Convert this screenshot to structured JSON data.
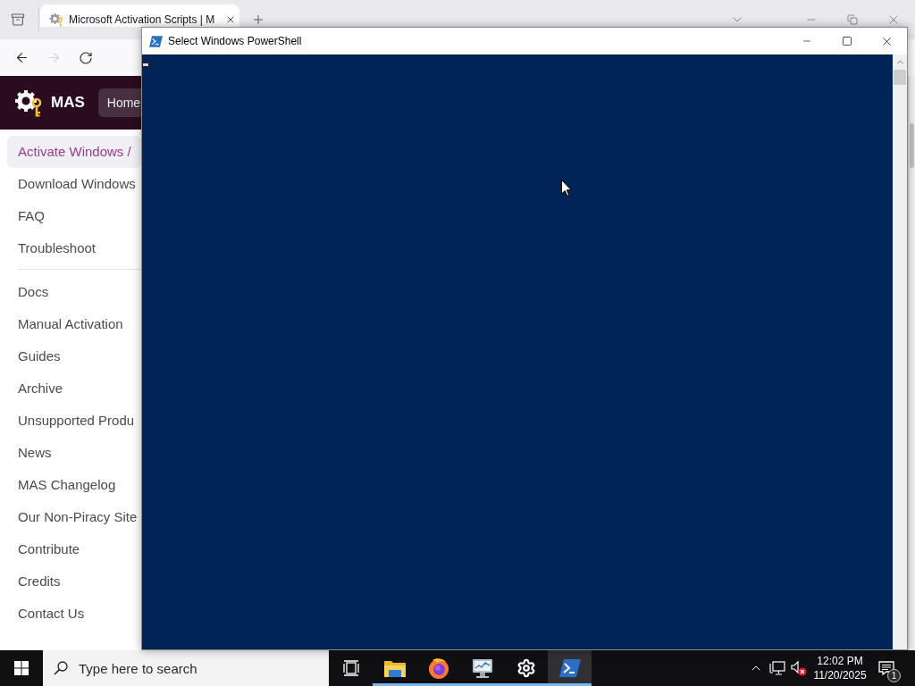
{
  "browser": {
    "tabs": [
      {
        "title": "Microsoft Activation Scripts | M",
        "selected": true
      }
    ],
    "nav_buttons": [
      {
        "kind": "back",
        "disabled": false
      },
      {
        "kind": "forward",
        "disabled": true
      },
      {
        "kind": "reload",
        "disabled": false
      }
    ],
    "site_header": {
      "logo_text": "MAS",
      "nav_link": "Home"
    },
    "sidebar": {
      "groups": [
        {
          "items": [
            {
              "label": "Activate Windows /",
              "selected": true
            },
            {
              "label": "Download Windows",
              "selected": false
            },
            {
              "label": "FAQ",
              "selected": false
            },
            {
              "label": "Troubleshoot",
              "selected": false
            }
          ]
        },
        {
          "items": [
            {
              "label": "Docs",
              "selected": false
            },
            {
              "label": "Manual Activation",
              "selected": false
            },
            {
              "label": "Guides",
              "selected": false
            },
            {
              "label": "Archive",
              "selected": false
            },
            {
              "label": "Unsupported Produ",
              "selected": false
            },
            {
              "label": "News",
              "selected": false
            },
            {
              "label": "MAS Changelog",
              "selected": false
            },
            {
              "label": "Our Non-Piracy Site",
              "selected": false
            },
            {
              "label": "Contribute",
              "selected": false
            },
            {
              "label": "Credits",
              "selected": false
            },
            {
              "label": "Contact Us",
              "selected": false
            }
          ]
        }
      ]
    }
  },
  "powershell_window": {
    "title": "Select Windows PowerShell"
  },
  "taskbar": {
    "search": {
      "placeholder": "Type here to search"
    },
    "apps": [
      {
        "kind": "file-explorer",
        "running": true,
        "selected": false
      },
      {
        "kind": "browser",
        "running": true,
        "selected": false
      },
      {
        "kind": "monitor",
        "running": true,
        "selected": false
      },
      {
        "kind": "settings",
        "running": true,
        "selected": false
      },
      {
        "kind": "powershell",
        "running": true,
        "selected": true
      }
    ],
    "clock": {
      "time": "12:02 PM",
      "date": "11/20/2025"
    },
    "notifications": {
      "count": "1"
    }
  }
}
